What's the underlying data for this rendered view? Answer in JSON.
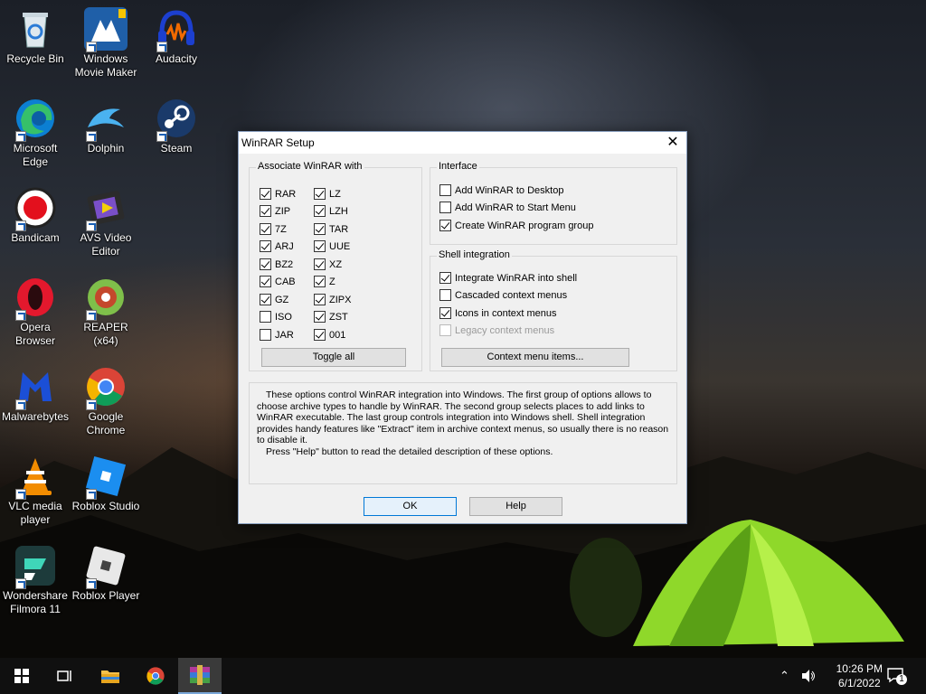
{
  "desktop": {
    "icons": [
      {
        "label": "Recycle Bin"
      },
      {
        "label": "Windows Movie Maker"
      },
      {
        "label": "Audacity"
      },
      {
        "label": "Microsoft Edge"
      },
      {
        "label": "Dolphin"
      },
      {
        "label": "Steam"
      },
      {
        "label": "Bandicam"
      },
      {
        "label": "AVS Video Editor"
      },
      {
        "label": "Opera Browser"
      },
      {
        "label": "REAPER (x64)"
      },
      {
        "label": "Malwarebytes"
      },
      {
        "label": "Google Chrome"
      },
      {
        "label": "VLC media player"
      },
      {
        "label": "Roblox Studio"
      },
      {
        "label": "Wondershare Filmora 11"
      },
      {
        "label": "Roblox Player"
      }
    ]
  },
  "dialog": {
    "title": "WinRAR Setup",
    "close": "✕",
    "associate": {
      "title": "Associate WinRAR with",
      "col1": [
        {
          "label": "RAR",
          "checked": true
        },
        {
          "label": "ZIP",
          "checked": true
        },
        {
          "label": "7Z",
          "checked": true
        },
        {
          "label": "ARJ",
          "checked": true
        },
        {
          "label": "BZ2",
          "checked": true
        },
        {
          "label": "CAB",
          "checked": true
        },
        {
          "label": "GZ",
          "checked": true
        },
        {
          "label": "ISO",
          "checked": false
        },
        {
          "label": "JAR",
          "checked": false
        }
      ],
      "col2": [
        {
          "label": "LZ",
          "checked": true
        },
        {
          "label": "LZH",
          "checked": true
        },
        {
          "label": "TAR",
          "checked": true
        },
        {
          "label": "UUE",
          "checked": true
        },
        {
          "label": "XZ",
          "checked": true
        },
        {
          "label": "Z",
          "checked": true
        },
        {
          "label": "ZIPX",
          "checked": true
        },
        {
          "label": "ZST",
          "checked": true
        },
        {
          "label": "001",
          "checked": true
        }
      ],
      "toggle_all": "Toggle all"
    },
    "interface": {
      "title": "Interface",
      "items": [
        {
          "label": "Add WinRAR to Desktop",
          "checked": false
        },
        {
          "label": "Add WinRAR to Start Menu",
          "checked": false
        },
        {
          "label": "Create WinRAR program group",
          "checked": true
        }
      ]
    },
    "shell": {
      "title": "Shell integration",
      "items": [
        {
          "label": "Integrate WinRAR into shell",
          "checked": true
        },
        {
          "label": "Cascaded context menus",
          "checked": false
        },
        {
          "label": "Icons in context menus",
          "checked": true
        },
        {
          "label": "Legacy context menus",
          "checked": false,
          "disabled": true
        }
      ],
      "context_button": "Context menu items..."
    },
    "description_p1": "These options control WinRAR integration into Windows. The first group of options allows to choose archive types to handle by WinRAR. The second group selects places to add links to WinRAR executable. The last group controls integration into Windows shell. Shell integration provides handy features like \"Extract\" item in archive context menus, so usually there is no reason to disable it.",
    "description_p2": "Press \"Help\" button to read the detailed description of these options.",
    "ok": "OK",
    "help": "Help"
  },
  "taskbar": {
    "time": "10:26 PM",
    "date": "6/1/2022",
    "notification_count": "1"
  }
}
